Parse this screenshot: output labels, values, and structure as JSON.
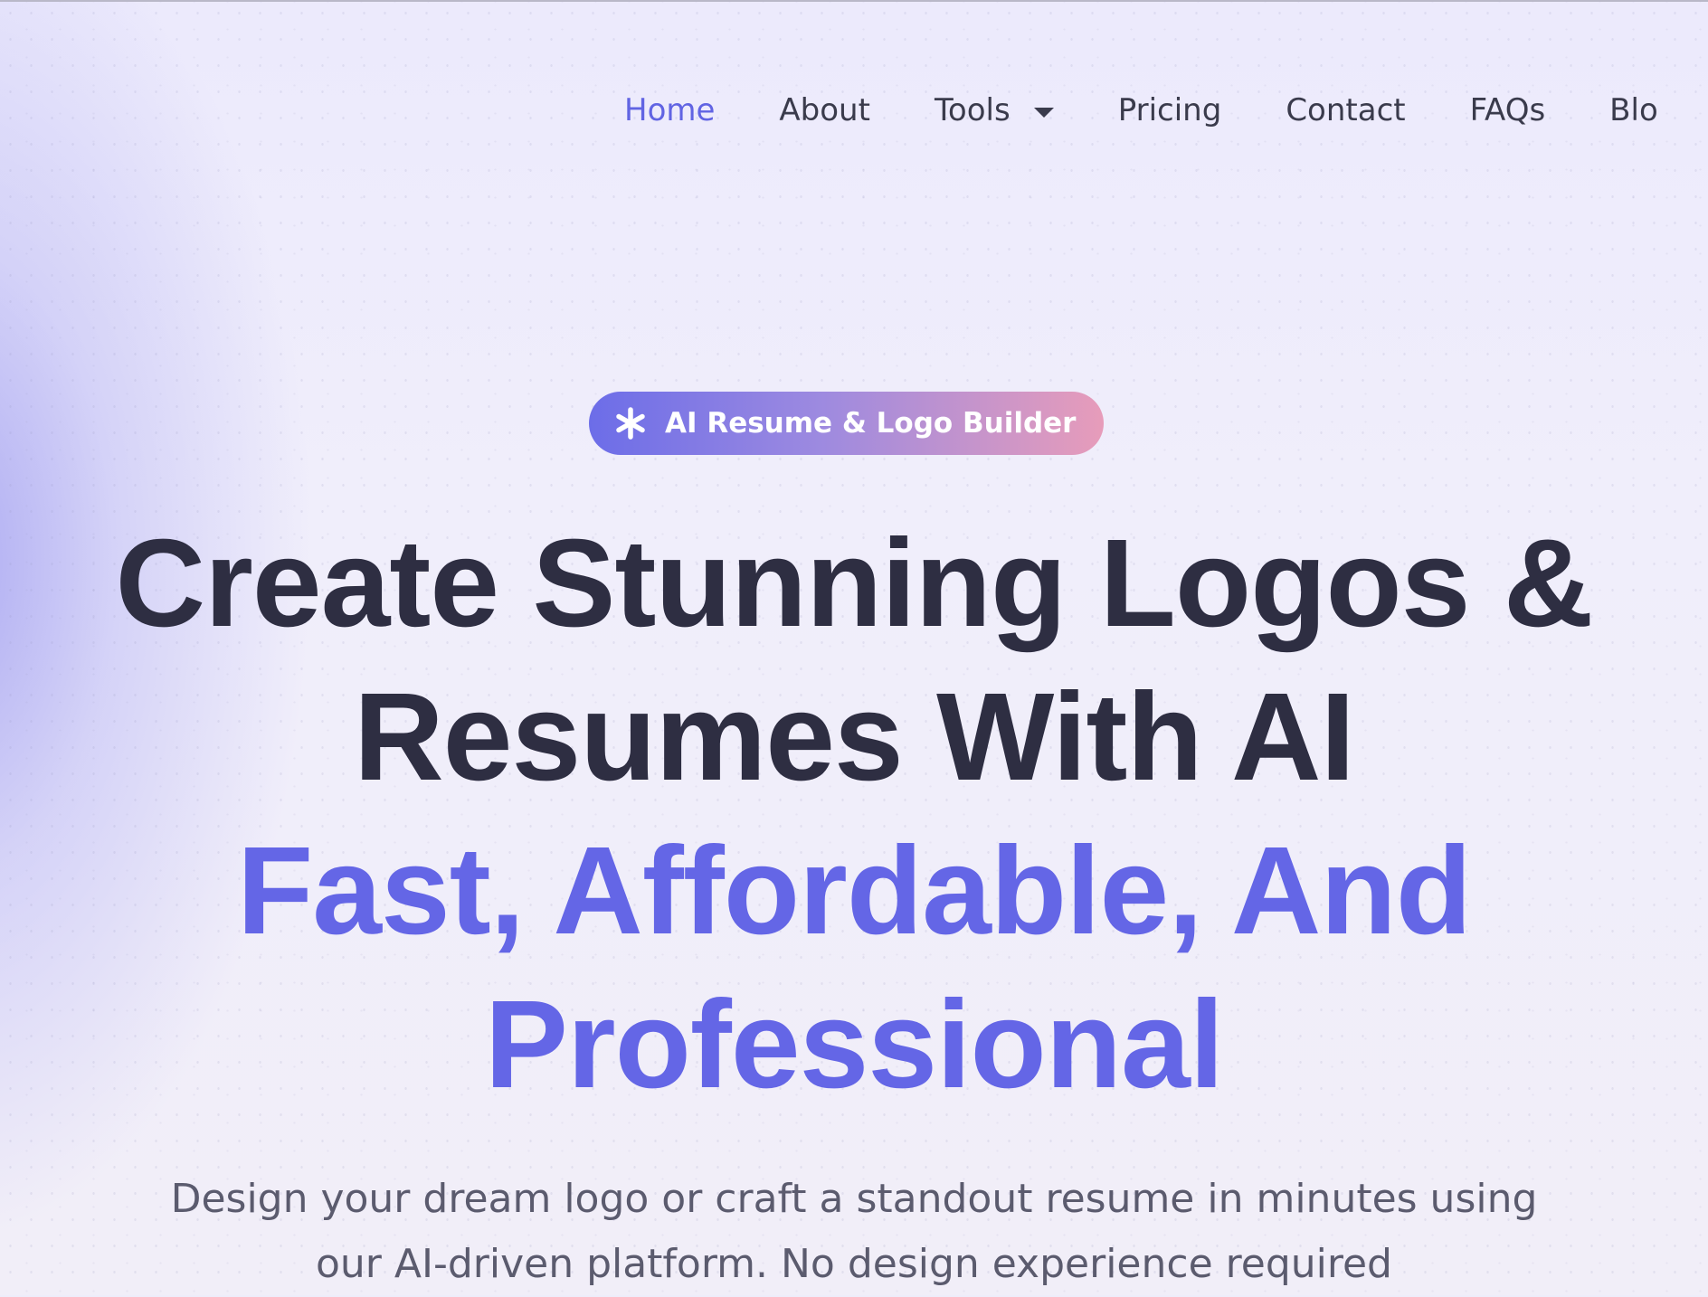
{
  "nav": {
    "items": [
      {
        "label": "Home",
        "active": true
      },
      {
        "label": "About"
      },
      {
        "label": "Tools",
        "has_dropdown": true
      },
      {
        "label": "Pricing"
      },
      {
        "label": "Contact"
      },
      {
        "label": "FAQs"
      },
      {
        "label": "Blo"
      }
    ]
  },
  "badge": {
    "icon": "asterisk-icon",
    "label": "AI Resume & Logo Builder"
  },
  "hero": {
    "title_line1": "Create Stunning Logos &",
    "title_line2": "Resumes With AI",
    "accent_line1": "Fast, Affordable, And",
    "accent_line2": "Professional",
    "description_line1": "Design your dream logo or craft a standout resume in minutes using",
    "description_line2": "our AI-driven platform. No design experience required"
  },
  "colors": {
    "accent": "#6466e6",
    "heading": "#2e2e42",
    "badge_gradient_start": "#6c6de8",
    "badge_gradient_end": "#e79cba"
  }
}
